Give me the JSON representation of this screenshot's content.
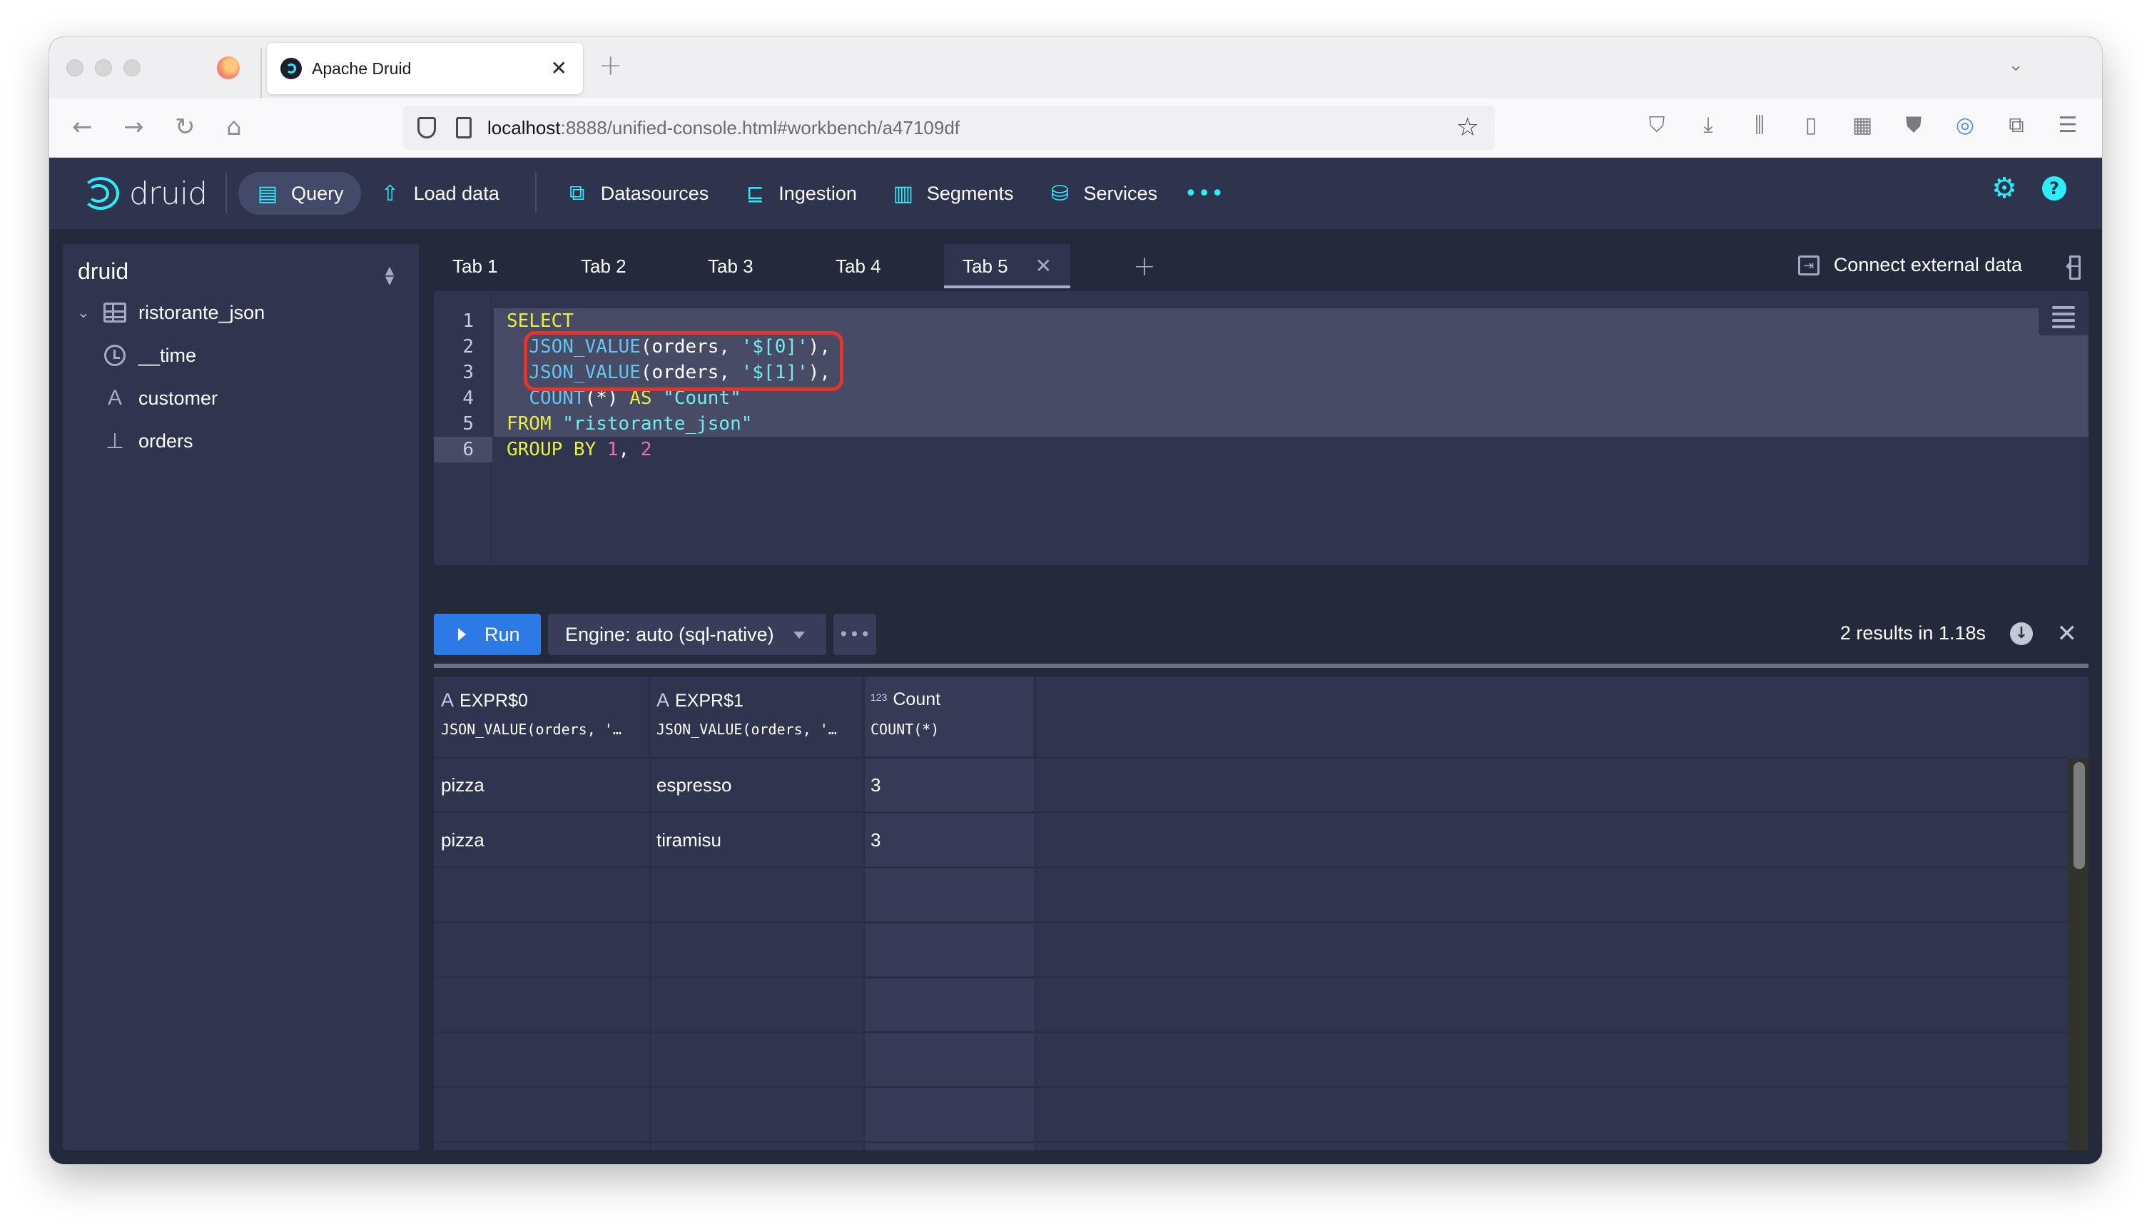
{
  "browser": {
    "tab_title": "Apache Druid",
    "url_host": "localhost",
    "url_rest": ":8888/unified-console.html#workbench/a47109df",
    "toolbar_icons": [
      "pocket-icon",
      "download-icon",
      "library-icon",
      "reader-view-icon",
      "container-icon",
      "ublock-icon",
      "password-manager-icon",
      "extensions-icon",
      "menu-icon"
    ]
  },
  "nav": {
    "logo_text": "druid",
    "items": [
      {
        "label": "Query",
        "icon": "query-icon",
        "active": true
      },
      {
        "label": "Load data",
        "icon": "cloud-upload-icon"
      },
      {
        "label": "Datasources",
        "icon": "datasources-icon"
      },
      {
        "label": "Ingestion",
        "icon": "ingestion-icon"
      },
      {
        "label": "Segments",
        "icon": "segments-icon"
      },
      {
        "label": "Services",
        "icon": "database-icon"
      }
    ],
    "more": "•••"
  },
  "sidebar": {
    "title": "druid",
    "datasource": "ristorante_json",
    "columns": [
      {
        "name": "__time",
        "type": "time"
      },
      {
        "name": "customer",
        "type": "string"
      },
      {
        "name": "orders",
        "type": "complex"
      }
    ]
  },
  "query_tabs": {
    "tabs": [
      "Tab 1",
      "Tab 2",
      "Tab 3",
      "Tab 4",
      "Tab 5"
    ],
    "active": "Tab 5",
    "connect_label": "Connect external data"
  },
  "editor": {
    "line_numbers": [
      "1",
      "2",
      "3",
      "4",
      "5",
      "6"
    ],
    "lines": [
      [
        {
          "t": "SELECT",
          "c": "kw"
        }
      ],
      [
        {
          "t": "  "
        },
        {
          "t": "JSON_VALUE",
          "c": "fn"
        },
        {
          "t": "(orders, "
        },
        {
          "t": "'$[0]'",
          "c": "str"
        },
        {
          "t": "),"
        }
      ],
      [
        {
          "t": "  "
        },
        {
          "t": "JSON_VALUE",
          "c": "fn"
        },
        {
          "t": "(orders, "
        },
        {
          "t": "'$[1]'",
          "c": "str"
        },
        {
          "t": "),"
        }
      ],
      [
        {
          "t": "  "
        },
        {
          "t": "COUNT",
          "c": "fn"
        },
        {
          "t": "(*) "
        },
        {
          "t": "AS",
          "c": "kw"
        },
        {
          "t": " "
        },
        {
          "t": "\"Count\"",
          "c": "str"
        }
      ],
      [
        {
          "t": "FROM",
          "c": "kw"
        },
        {
          "t": " "
        },
        {
          "t": "\"ristorante_json\"",
          "c": "str"
        }
      ],
      [
        {
          "t": "GROUP BY",
          "c": "kw"
        },
        {
          "t": " "
        },
        {
          "t": "1",
          "c": "num"
        },
        {
          "t": ", "
        },
        {
          "t": "2",
          "c": "num"
        }
      ]
    ],
    "current_line": 6,
    "annotation_color": "#e5352a"
  },
  "runbar": {
    "run_label": "Run",
    "engine_label": "Engine: auto (sql-native)",
    "more_label": "•••",
    "result_info": "2 results in 1.18s"
  },
  "results": {
    "columns": [
      {
        "name": "EXPR$0",
        "expr": "JSON_VALUE(orders, '…",
        "type": "string"
      },
      {
        "name": "EXPR$1",
        "expr": "JSON_VALUE(orders, '…",
        "type": "string"
      },
      {
        "name": "Count",
        "expr": "COUNT(*)",
        "type": "number"
      }
    ],
    "rows": [
      [
        "pizza",
        "espresso",
        "3"
      ],
      [
        "pizza",
        "tiramisu",
        "3"
      ]
    ]
  },
  "colors": {
    "accent": "#2ceefb",
    "run_button": "#2d7ae6",
    "header_bg": "#2f344e",
    "panel_bg": "#30354f"
  }
}
